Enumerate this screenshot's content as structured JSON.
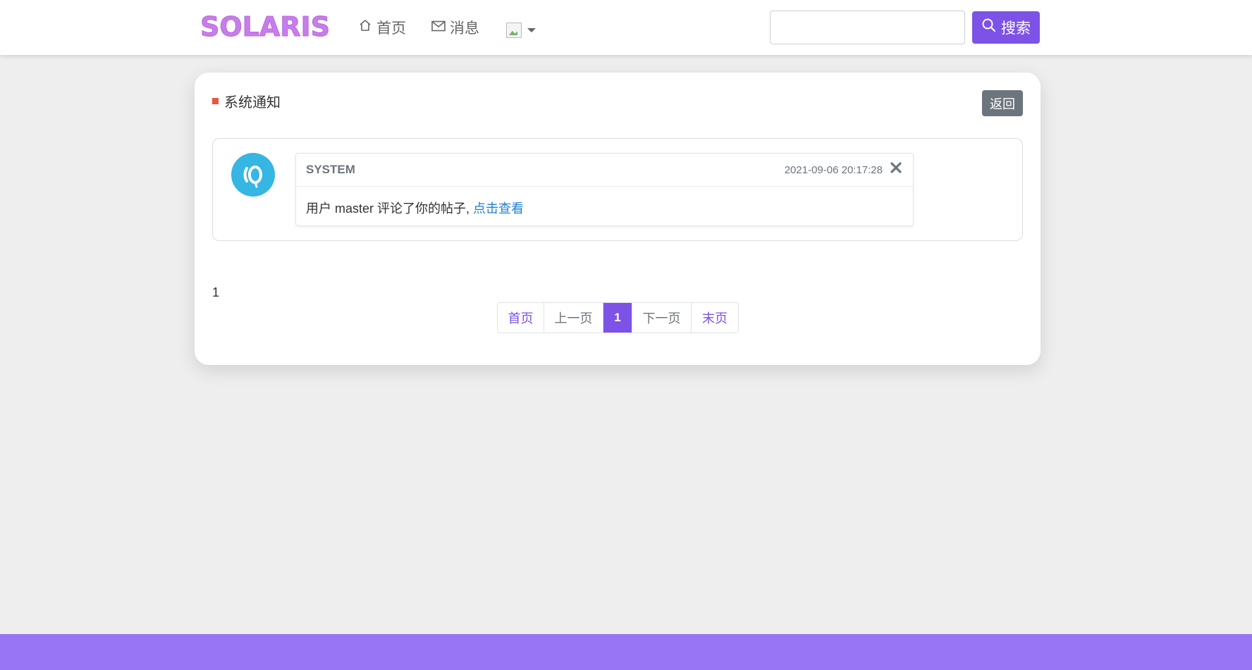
{
  "header": {
    "logo": "SOLARIS",
    "nav": {
      "home_label": "首页",
      "messages_label": "消息"
    },
    "search": {
      "placeholder": "",
      "button_label": "搜索"
    }
  },
  "notice_page": {
    "title": "系统通知",
    "back_label": "返回",
    "notification": {
      "sender": "SYSTEM",
      "time": "2021-09-06 20:17:28",
      "message": "用户 master 评论了你的帖子,",
      "link_text": "点击查看"
    },
    "page_count": "1",
    "pagination": {
      "first": "首页",
      "prev": "上一页",
      "current": "1",
      "next": "下一页",
      "last": "末页"
    }
  },
  "colors": {
    "accent": "#7d52e6",
    "footer": "#9875f5",
    "logo": "#c77dea",
    "marker": "#e8563c",
    "link": "#1f7fd6",
    "avatar": "#35b6e3"
  },
  "icons": {
    "home": "home-icon",
    "messages": "envelope-icon",
    "search": "search-icon",
    "close": "close-icon",
    "avatar": "system-avatar-icon"
  }
}
